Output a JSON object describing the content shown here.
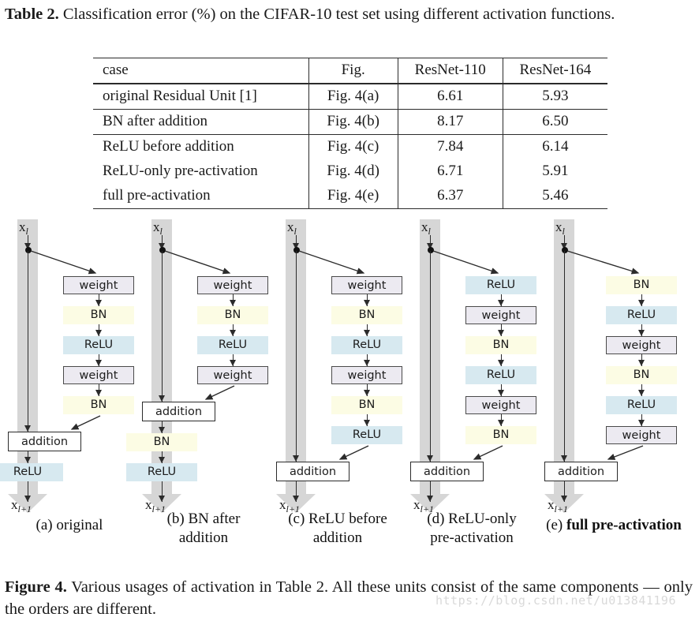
{
  "table_caption": {
    "lead": "Table 2.",
    "text": " Classification error (%) on the CIFAR-10 test set using different activation functions."
  },
  "table": {
    "headers": [
      "case",
      "Fig.",
      "ResNet-110",
      "ResNet-164"
    ],
    "rows": [
      {
        "case": "original Residual Unit [1]",
        "fig": "Fig. 4(a)",
        "r110": "6.61",
        "r164": "5.93",
        "bold": false
      },
      {
        "case": "BN after addition",
        "fig": "Fig. 4(b)",
        "r110": "8.17",
        "r164": "6.50",
        "bold": false
      },
      {
        "case": "ReLU before addition",
        "fig": "Fig. 4(c)",
        "r110": "7.84",
        "r164": "6.14",
        "bold": false
      },
      {
        "case": "ReLU-only pre-activation",
        "fig": "Fig. 4(d)",
        "r110": "6.71",
        "r164": "5.91",
        "bold": false
      },
      {
        "case": "full pre-activation",
        "fig": "Fig. 4(e)",
        "r110": "6.37",
        "r164": "5.46",
        "bold": true
      }
    ]
  },
  "figure": {
    "input_label": "x",
    "input_sub": "l",
    "output_label": "x",
    "output_sub": "l+1",
    "addition_label": "addition",
    "panels": [
      {
        "id": "a",
        "caption_line1": "(a) original",
        "caption_line2": "",
        "bold_caption": false,
        "residual": [
          "weight",
          "BN",
          "ReLU",
          "weight",
          "BN"
        ],
        "after_addition": [
          "ReLU"
        ]
      },
      {
        "id": "b",
        "caption_line1": "(b) BN after",
        "caption_line2": "addition",
        "bold_caption": false,
        "residual": [
          "weight",
          "BN",
          "ReLU",
          "weight"
        ],
        "after_addition": [
          "BN",
          "ReLU"
        ]
      },
      {
        "id": "c",
        "caption_line1": "(c) ReLU before",
        "caption_line2": "addition",
        "bold_caption": false,
        "residual": [
          "weight",
          "BN",
          "ReLU",
          "weight",
          "BN",
          "ReLU"
        ],
        "after_addition": []
      },
      {
        "id": "d",
        "caption_line1": "(d) ReLU-only",
        "caption_line2": "pre-activation",
        "bold_caption": false,
        "residual": [
          "ReLU",
          "weight",
          "BN",
          "ReLU",
          "weight",
          "BN"
        ],
        "after_addition": []
      },
      {
        "id": "e",
        "caption_line1": "(e) ",
        "caption_line2": "full pre-activation",
        "bold_caption": true,
        "residual": [
          "BN",
          "ReLU",
          "weight",
          "BN",
          "ReLU",
          "weight"
        ],
        "after_addition": []
      }
    ],
    "colors": {
      "weight_fill": "#eceaf1",
      "weight_border": "#4a4a4a",
      "bn_fill": "#fcfce4",
      "relu_fill": "#d7e9f0",
      "shortcut_fill": "#d6d6d6",
      "line": "#2b2b2b"
    }
  },
  "figure_caption": {
    "lead": "Figure 4.",
    "text": " Various usages of activation in Table 2. All these units consist of the same components — only the orders are different."
  },
  "watermark": "https://blog.csdn.net/u013841196"
}
